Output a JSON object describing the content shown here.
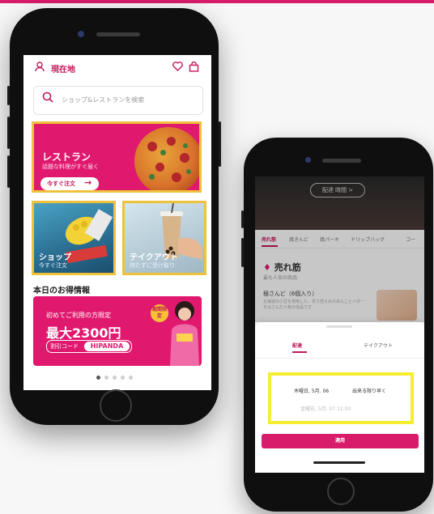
{
  "phone1": {
    "header": {
      "location_label": "現在地"
    },
    "search": {
      "placeholder": "ショップ&レストランを検索"
    },
    "restaurant_card": {
      "title": "レストラン",
      "subtitle": "話題な料理がすぐ届く",
      "cta": "今すぐ注文"
    },
    "shop_card": {
      "title": "ショップ",
      "subtitle": "今すぐ注文"
    },
    "takeout_card": {
      "title": "テイクアウト",
      "subtitle": "待たずに受け取り"
    },
    "deals_heading": "本日のお得情報",
    "promo_banner": {
      "line1": "初めてご利用の方限定",
      "line2": "最大2300円",
      "code_label": "割引コード",
      "code": "HIPANDA",
      "badge": "期間限定"
    },
    "carousel": {
      "count": 5,
      "active": 1
    }
  },
  "phone2": {
    "store_pill": "配達 時間 >",
    "tabs": [
      "売れ筋",
      "焼きんど",
      "焼パーキ",
      "ドリップバッグ",
      "コー"
    ],
    "section": {
      "title": "売れ筋",
      "subtitle": "最も人気の商品"
    },
    "item": {
      "name": "極さんど（6個入り）",
      "description": "北海道の小豆を使用した、甘さ控えめのあんことバターをはさんだ人気の逸品です"
    },
    "sheet": {
      "tabs": [
        "配達",
        "テイクアウト"
      ],
      "active_tab": 0,
      "selected_time": "木曜日, 5月. 06",
      "selected_time_option": "出来る限り早く",
      "alt_time": "金曜日, 5月. 07  11:00",
      "apply_label": "適用"
    }
  },
  "colors": {
    "brand": "#e0196f",
    "highlight_yellow": "#f0c23b",
    "highlight_lime": "#f4ee2e"
  }
}
